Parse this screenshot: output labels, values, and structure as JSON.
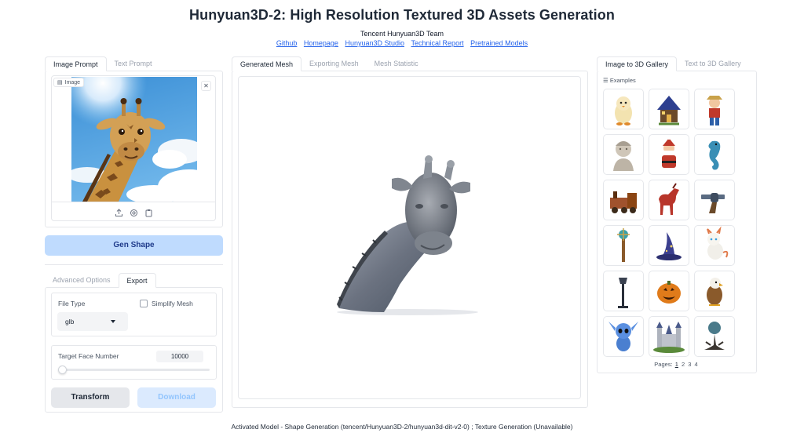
{
  "header": {
    "title": "Hunyuan3D-2: High Resolution Textured 3D Assets Generation",
    "team": "Tencent Hunyuan3D Team",
    "links": [
      "Github",
      "Homepage",
      "Hunyuan3D Studio",
      "Technical Report",
      "Pretrained Models"
    ]
  },
  "left": {
    "tabs": [
      "Image Prompt",
      "Text Prompt"
    ],
    "active_tab": "Image Prompt",
    "image_label": "Image",
    "gen_button": "Gen Shape",
    "option_tabs": [
      "Advanced Options",
      "Export"
    ],
    "active_option_tab": "Export",
    "file_type_label": "File Type",
    "file_type_value": "glb",
    "simplify_label": "Simplify Mesh",
    "simplify_checked": false,
    "target_face_label": "Target Face Number",
    "target_face_value": "10000",
    "target_face_fraction": 0.0,
    "transform_button": "Transform",
    "download_button": "Download"
  },
  "center": {
    "tabs": [
      "Generated Mesh",
      "Exporting Mesh",
      "Mesh Statistic"
    ],
    "active_tab": "Generated Mesh"
  },
  "gallery": {
    "tabs": [
      "Image to 3D Gallery",
      "Text to 3D Gallery"
    ],
    "active_tab": "Image to 3D Gallery",
    "examples_label": "Examples",
    "items": [
      "penguin-doll",
      "blue-house",
      "pirate-boy",
      "stone-bust",
      "santa",
      "seahorse",
      "toy-train",
      "red-horse",
      "revolver",
      "magic-staff",
      "wizard-hat",
      "white-dragon",
      "street-lamp",
      "pumpkin",
      "eagle",
      "stitch",
      "castle",
      "globe-tree"
    ],
    "pages_label": "Pages:",
    "pages": [
      "1",
      "2",
      "3",
      "4"
    ],
    "current_page": "1"
  },
  "footer": "Activated Model - Shape Generation (tencent/Hunyuan3D-2/hunyuan3d-dit-v2-0) ; Texture Generation (Unavailable)"
}
